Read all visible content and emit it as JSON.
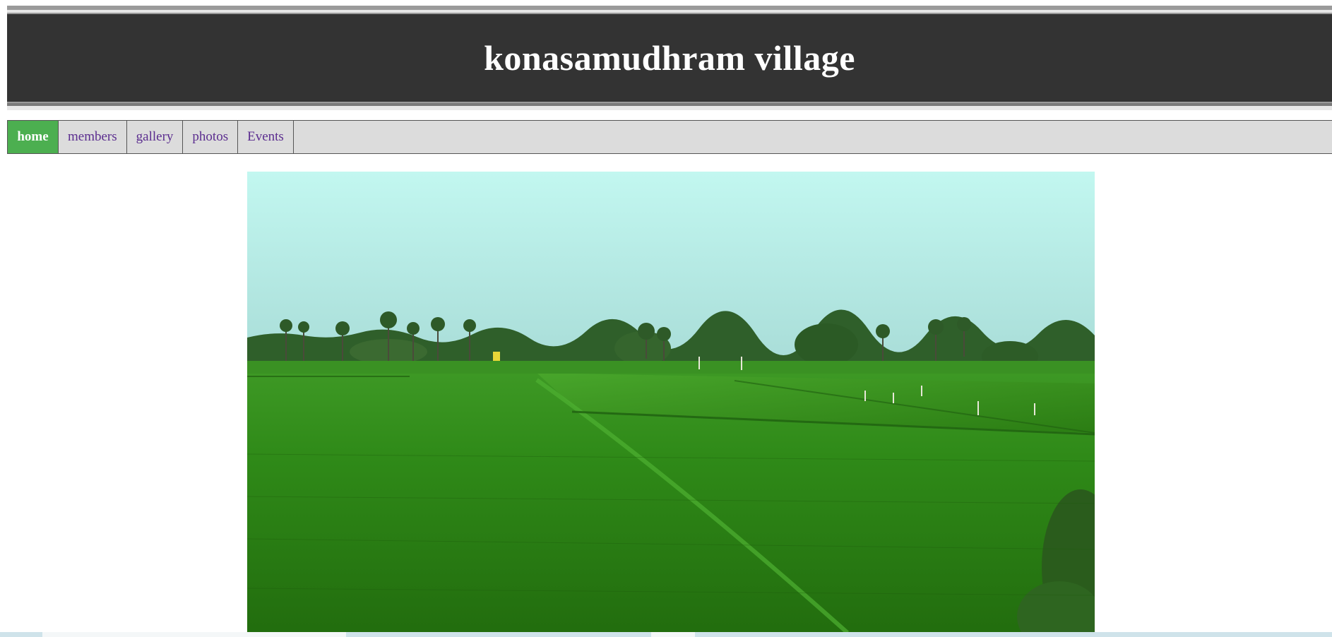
{
  "header": {
    "title": "konasamudhram village"
  },
  "nav": {
    "items": [
      {
        "label": "home",
        "active": true
      },
      {
        "label": "members",
        "active": false
      },
      {
        "label": "gallery",
        "active": false
      },
      {
        "label": "photos",
        "active": false
      },
      {
        "label": "Events",
        "active": false
      }
    ]
  },
  "colors": {
    "header_bg": "#333333",
    "nav_bg": "#dcdcdc",
    "nav_active": "#4caf50",
    "nav_link": "#5b2d8f"
  }
}
